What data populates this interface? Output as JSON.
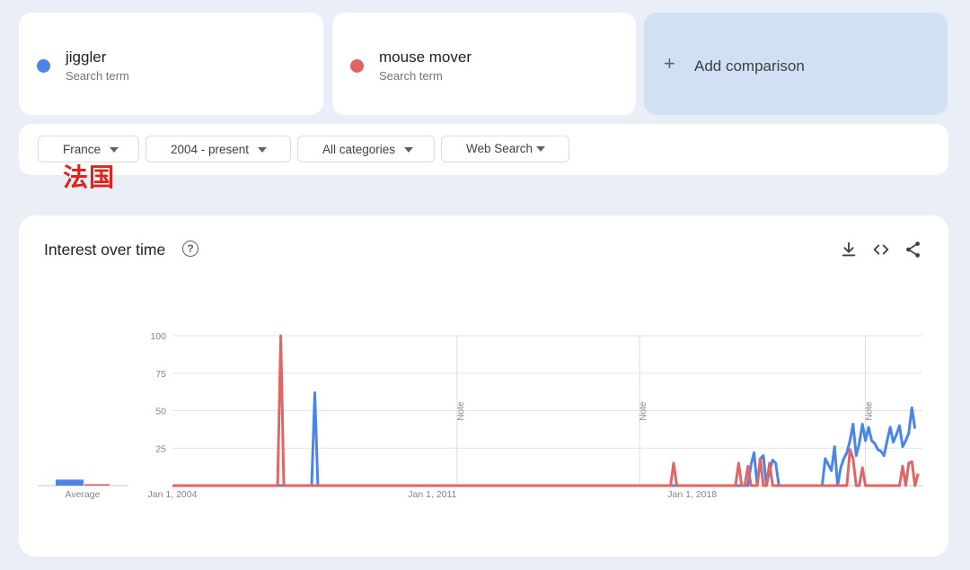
{
  "terms": [
    {
      "name": "jiggler",
      "sub": "Search term",
      "color": "#4a86e8"
    },
    {
      "name": "mouse mover",
      "sub": "Search term",
      "color": "#e06666"
    }
  ],
  "add_comparison": {
    "icon": "+",
    "label": "Add comparison"
  },
  "filters": {
    "region": "France",
    "time": "2004 - present",
    "category": "All categories",
    "search_type": "Web Search"
  },
  "overlay_label": "法国",
  "panel": {
    "title": "Interest over time",
    "help_icon": "?",
    "icons": [
      "download-icon",
      "embed-code-icon",
      "share-icon"
    ]
  },
  "chart_data": {
    "type": "line",
    "title": "Interest over time",
    "ylim": [
      0,
      100
    ],
    "yticks": [
      100,
      75,
      50,
      25
    ],
    "x_tick_labels": [
      "Jan 1, 2004",
      "Jan 1, 2011",
      "Jan 1, 2018"
    ],
    "notes": [
      {
        "date": "2011-09",
        "label": "Note"
      },
      {
        "date": "2016-08",
        "label": "Note"
      },
      {
        "date": "2022-09",
        "label": "Note"
      }
    ],
    "average_label": "Average",
    "averages": [
      4,
      1
    ],
    "series": [
      {
        "name": "jiggler",
        "color": "#4a86e8",
        "points": [
          [
            "2004-01",
            0
          ],
          [
            "2007-10",
            0
          ],
          [
            "2007-11",
            62
          ],
          [
            "2007-12",
            0
          ],
          [
            "2019-07",
            0
          ],
          [
            "2019-08",
            14
          ],
          [
            "2019-09",
            22
          ],
          [
            "2019-10",
            0
          ],
          [
            "2019-11",
            18
          ],
          [
            "2019-12",
            20
          ],
          [
            "2020-01",
            0
          ],
          [
            "2020-02",
            10
          ],
          [
            "2020-03",
            17
          ],
          [
            "2020-04",
            15
          ],
          [
            "2020-05",
            0
          ],
          [
            "2021-07",
            0
          ],
          [
            "2021-08",
            18
          ],
          [
            "2021-09",
            14
          ],
          [
            "2021-10",
            10
          ],
          [
            "2021-11",
            26
          ],
          [
            "2021-12",
            0
          ],
          [
            "2022-01",
            12
          ],
          [
            "2022-02",
            18
          ],
          [
            "2022-03",
            22
          ],
          [
            "2022-04",
            30
          ],
          [
            "2022-05",
            41
          ],
          [
            "2022-06",
            20
          ],
          [
            "2022-07",
            28
          ],
          [
            "2022-08",
            41
          ],
          [
            "2022-09",
            30
          ],
          [
            "2022-10",
            39
          ],
          [
            "2022-11",
            30
          ],
          [
            "2022-12",
            28
          ],
          [
            "2023-01",
            24
          ],
          [
            "2023-02",
            23
          ],
          [
            "2023-03",
            20
          ],
          [
            "2023-04",
            30
          ],
          [
            "2023-05",
            39
          ],
          [
            "2023-06",
            29
          ],
          [
            "2023-07",
            34
          ],
          [
            "2023-08",
            40
          ],
          [
            "2023-09",
            26
          ],
          [
            "2023-10",
            30
          ],
          [
            "2023-11",
            35
          ],
          [
            "2023-12",
            52
          ],
          [
            "2024-01",
            38
          ]
        ]
      },
      {
        "name": "mouse mover",
        "color": "#e06666",
        "points": [
          [
            "2004-01",
            0
          ],
          [
            "2006-11",
            0
          ],
          [
            "2006-12",
            100
          ],
          [
            "2007-01",
            0
          ],
          [
            "2017-06",
            0
          ],
          [
            "2017-07",
            15
          ],
          [
            "2017-08",
            0
          ],
          [
            "2019-03",
            0
          ],
          [
            "2019-04",
            15
          ],
          [
            "2019-05",
            0
          ],
          [
            "2019-06",
            0
          ],
          [
            "2019-07",
            13
          ],
          [
            "2019-08",
            0
          ],
          [
            "2019-10",
            0
          ],
          [
            "2019-11",
            18
          ],
          [
            "2019-12",
            0
          ],
          [
            "2020-01",
            0
          ],
          [
            "2020-02",
            15
          ],
          [
            "2020-03",
            0
          ],
          [
            "2022-03",
            0
          ],
          [
            "2022-04",
            24
          ],
          [
            "2022-05",
            18
          ],
          [
            "2022-06",
            0
          ],
          [
            "2022-07",
            0
          ],
          [
            "2022-08",
            12
          ],
          [
            "2022-09",
            0
          ],
          [
            "2022-10",
            0
          ],
          [
            "2023-08",
            0
          ],
          [
            "2023-09",
            13
          ],
          [
            "2023-10",
            0
          ],
          [
            "2023-11",
            15
          ],
          [
            "2023-12",
            16
          ],
          [
            "2024-01",
            0
          ],
          [
            "2024-02",
            8
          ]
        ]
      }
    ]
  }
}
